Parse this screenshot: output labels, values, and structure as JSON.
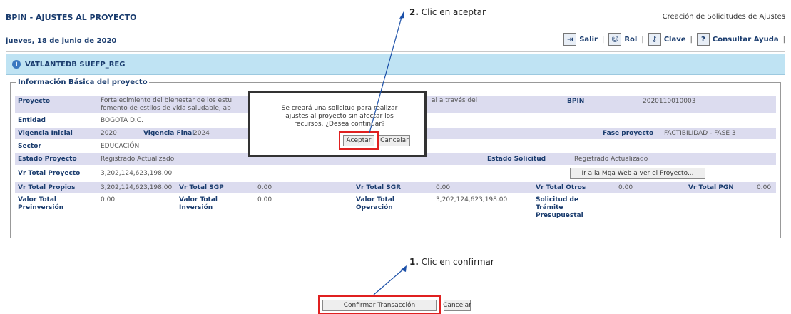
{
  "header": {
    "title": "BPIN - AJUSTES AL PROYECTO",
    "right_title": "Creación de Solicitudes de Ajustes"
  },
  "date": "jueves, 18 de junio de 2020",
  "toolbar": {
    "salir": "Salir",
    "rol": "Rol",
    "clave": "Clave",
    "ayuda": "Consultar Ayuda",
    "separator": "|"
  },
  "user": "VATLANTEDB SUEFP_REG",
  "section": {
    "legend": "Información Básica del proyecto",
    "proyecto_label": "Proyecto",
    "proyecto_value_1": "Fortalecimiento del bienestar de los estu",
    "proyecto_value_2": "fomento de estilos de vida saludable, ab",
    "proyecto_value_tail": "al a través del",
    "bpin_label": "BPIN",
    "bpin_value": "2020110010003",
    "entidad_label": "Entidad",
    "entidad_value": "BOGOTA D.C.",
    "vig_ini_label": "Vigencia Inicial",
    "vig_ini_value": "2020",
    "vig_fin_label": "Vigencia Final",
    "vig_fin_value": "2024",
    "fase_label": "Fase proyecto",
    "fase_value": "FACTIBILIDAD - FASE 3",
    "sector_label": "Sector",
    "sector_value": "EDUCACIÓN",
    "estado_proy_label": "Estado Proyecto",
    "estado_proy_value": "Registrado Actualizado",
    "estado_sol_label": "Estado Solicitud",
    "estado_sol_value": "Registrado Actualizado",
    "vr_total_proy_label": "Vr Total Proyecto",
    "vr_total_proy_value": "3,202,124,623,198.00",
    "mga_button": "Ir a la Mga Web a ver el Proyecto...",
    "vr_propios_label": "Vr Total Propios",
    "vr_propios_value": "3,202,124,623,198.00",
    "vr_sgp_label": "Vr Total SGP",
    "vr_sgp_value": "0.00",
    "vr_sgr_label": "Vr Total SGR",
    "vr_sgr_value": "0.00",
    "vr_otros_label": "Vr Total Otros",
    "vr_otros_value": "0.00",
    "vr_pgn_label": "Vr Total PGN",
    "vr_pgn_value": "0.00",
    "preinv_label_1": "Valor Total",
    "preinv_label_2": "Preinversión",
    "preinv_value": "0.00",
    "inv_label_1": "Valor Total",
    "inv_label_2": "Inversión",
    "inv_value": "0.00",
    "oper_label_1": "Valor Total",
    "oper_label_2": "Operación",
    "oper_value": "3,202,124,623,198.00",
    "tramite_label_1": "Solicitud de",
    "tramite_label_2": "Trámite",
    "tramite_label_3": "Presupuestal"
  },
  "modal": {
    "line1": "Se creará una solicitud para realizar",
    "line2": "ajustes al proyecto sin afectar los",
    "line3": "recursos. ¿Desea continuar?",
    "accept": "Aceptar",
    "cancel": "Cancelar"
  },
  "footer": {
    "confirm": "Confirmar Transacción",
    "cancel": "Cancelar"
  },
  "annotations": {
    "step1_num": "1.",
    "step1_text": "Clic en confirmar",
    "step2_num": "2.",
    "step2_text": "Clic en aceptar"
  },
  "colors": {
    "highlight": "#e02020",
    "userbar": "#bfe3f3",
    "row_shade": "#dcdcef",
    "label": "#1a3c6e"
  }
}
